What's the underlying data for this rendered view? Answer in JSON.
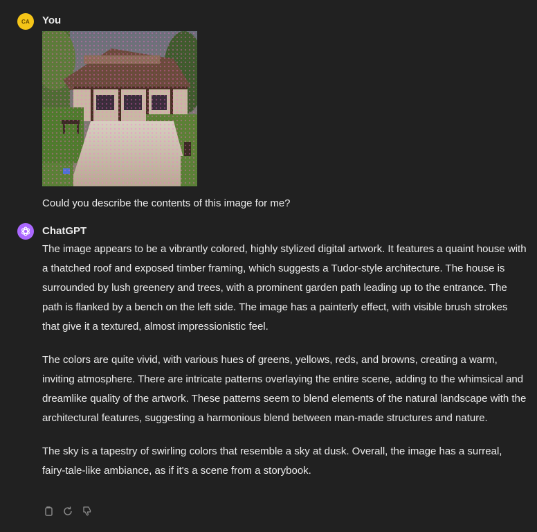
{
  "user_message": {
    "avatar_initials": "CA",
    "author": "You",
    "text": "Could you describe the contents of this image for me?"
  },
  "assistant_message": {
    "author": "ChatGPT",
    "paragraphs": [
      "The image appears to be a vibrantly colored, highly stylized digital artwork. It features a quaint house with a thatched roof and exposed timber framing, which suggests a Tudor-style architecture. The house is surrounded by lush greenery and trees, with a prominent garden path leading up to the entrance. The path is flanked by a bench on the left side. The image has a painterly effect, with visible brush strokes that give it a textured, almost impressionistic feel.",
      "The colors are quite vivid, with various hues of greens, yellows, reds, and browns, creating a warm, inviting atmosphere. There are intricate patterns overlaying the entire scene, adding to the whimsical and dreamlike quality of the artwork. These patterns seem to blend elements of the natural landscape with the architectural features, suggesting a harmonious blend between man-made structures and nature.",
      "The sky is a tapestry of swirling colors that resemble a sky at dusk. Overall, the image has a surreal, fairy-tale-like ambiance, as if it's a scene from a storybook."
    ],
    "actions": [
      "copy-icon",
      "regenerate-icon",
      "thumbs-down-icon"
    ]
  },
  "colors": {
    "background": "#212121",
    "text": "#ececec",
    "user_avatar": "#f5c518",
    "assistant_avatar": "#ab68ff",
    "action_icon": "#8e8e8e"
  }
}
